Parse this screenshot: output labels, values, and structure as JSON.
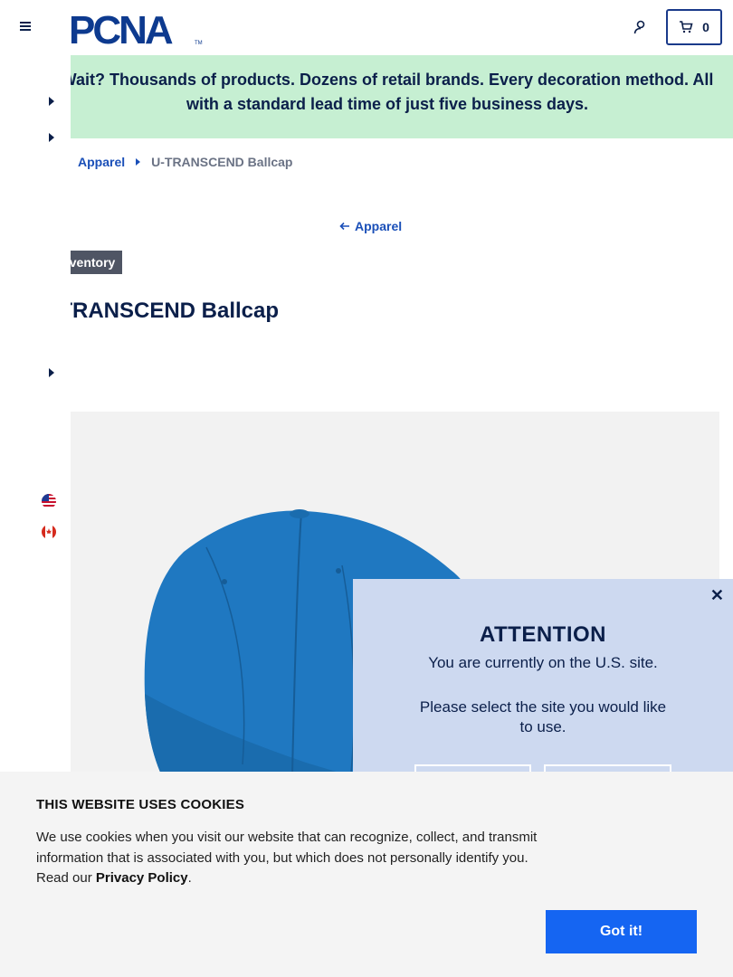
{
  "header": {
    "logo_text": "PCNA",
    "logo_tm": "TM",
    "cart_count": "0",
    "icons": {
      "menu": "hamburger-menu-icon",
      "account": "user-icon",
      "cart": "cart-icon"
    }
  },
  "promo": {
    "text": "Wait? Thousands of products. Dozens of retail brands. Every decoration method. All\nwith a standard lead time of just five business days."
  },
  "breadcrumb": {
    "items": [
      {
        "label": "Apparel",
        "link": true
      },
      {
        "label": "U-TRANSCEND Ballcap",
        "link": false
      }
    ]
  },
  "back_link": {
    "label": "Apparel"
  },
  "product": {
    "badge": "In Inventory",
    "title": "U-TRANSCEND Ballcap",
    "cap_color": "#1f78c1"
  },
  "side_rail": {
    "flags": [
      "us-flag-icon",
      "canada-flag-icon"
    ]
  },
  "modal": {
    "title": "ATTENTION",
    "line1": "You are currently on the U.S. site.",
    "line2": "Please select the site you would like to use.",
    "close_icon": "close-icon"
  },
  "cookie": {
    "title": "THIS WEBSITE USES COOKIES",
    "text": "We use cookies when you visit our website that can recognize, collect, and transmit information that is associated with you, but which does not personally identify you. Read our ",
    "link": "Privacy Policy",
    "period": ".",
    "button": "Got it!"
  },
  "colors": {
    "navy": "#0b1f4a",
    "brand_blue": "#1a4fb8",
    "promo_bg": "#c6efd2",
    "modal_bg": "#cdd9f0",
    "button_blue": "#1565f2"
  }
}
